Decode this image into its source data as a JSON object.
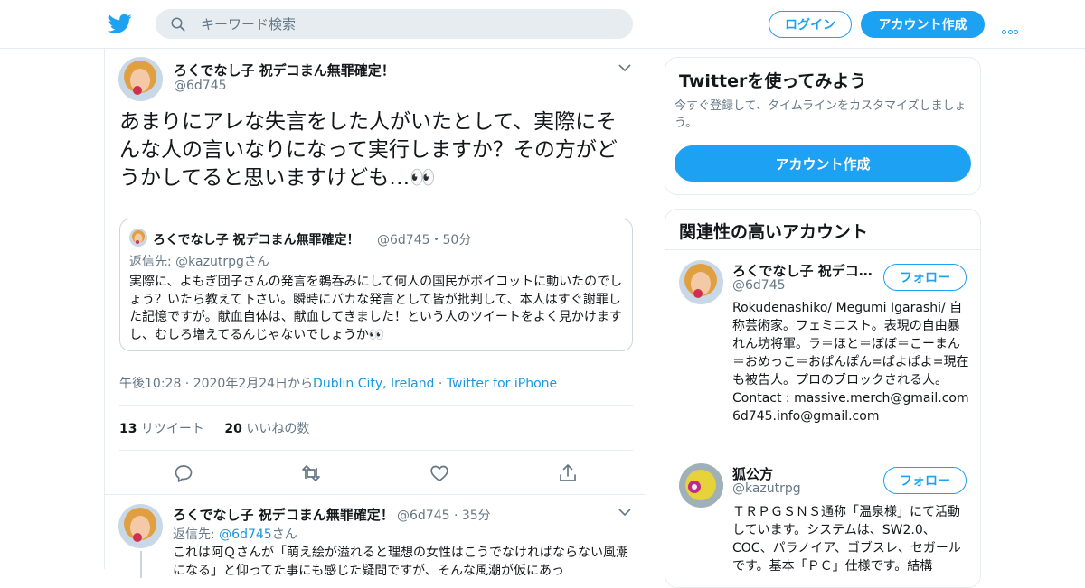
{
  "header": {
    "logo_icon": "twitter-bird-icon",
    "search_placeholder": "キーワード検索",
    "login_label": "ログイン",
    "signup_label": "アカウント作成",
    "more_icon": "more-dots-icon"
  },
  "tweet": {
    "author_name": "ろくでなし子 祝デコまん無罪確定！",
    "author_handle": "@6d745",
    "text": "あまりにアレな失言をした人がいたとして、実際にそんな人の言いなりになって実行しますか？その方がどうかしてると思いますけども…👀",
    "quote": {
      "name": "ろくでなし子 祝デコまん無罪確定！",
      "handle_time": "@6d745・50分",
      "reply_to": "返信先: @kazutrpgさん",
      "text": "実際に、よもぎ団子さんの発言を鵜呑みにして何人の国民がボイコットに動いたのでしょう？いたら教えて下さい。瞬時にバカな発言として皆が批判して、本人はすぐ謝罪した記憶ですが。献血自体は、献血してきました！という人のツイートをよく見かけますし、むしろ増えてるんじゃないでしょうか👀"
    },
    "time_prefix": "午後10:28 · 2020年2月24日から",
    "location": "Dublin City, Ireland",
    "source_sep": " · ",
    "source": "Twitter for iPhone",
    "retweet_count": "13",
    "retweet_label": " リツイート",
    "like_count": "20",
    "like_label": " いいねの数"
  },
  "actions": [
    "reply-icon",
    "retweet-icon",
    "like-icon",
    "share-icon"
  ],
  "reply": {
    "author_name": "ろくでなし子 祝デコまん無罪確定！",
    "handle_time": "@6d745 · 35分",
    "reply_to_prefix": "返信先: ",
    "reply_to_handle": "@6d745",
    "reply_to_suffix": "さん",
    "text": "これは阿Ｑさんが「萌え絵が溢れると理想の女性はこうでなければならない風潮になる」と仰ってた事にも感じた疑問ですが、そんな風潮が仮にあっ"
  },
  "sidebar": {
    "signup_card": {
      "title": "Twitterを使ってみよう",
      "desc": "今すぐ登録して、タイムラインをカスタマイズしましょう。",
      "button": "アカウント作成"
    },
    "related": {
      "title": "関連性の高いアカウント",
      "follow_label": "フォロー",
      "accounts": [
        {
          "name": "ろくでなし子 祝デコ…",
          "handle": "@6d745",
          "bio": "Rokudenashiko/ Megumi Igarashi/ 自称芸術家。フェミニスト。表現の自由暴れん坊将軍。ラ＝ほと＝ぼぼ＝こーまん＝おめっこ＝おぱんぽん=ぱよぱよ=現在も被告人。プロのブロックされる人。Contact : massive.merch@gmail.com 6d745.info@gmail.com"
        },
        {
          "name": "狐公方",
          "handle": "@kazutrpg",
          "bio": "ＴＲＰＧＳＮＳ通称「温泉様」にて活動しています。システムは、SW2.0、COC、パラノイア、ゴブスレ、セガールです。基本「ＰＣ」仕様です。結構"
        }
      ]
    }
  },
  "colors": {
    "accent": "#1da1f2",
    "link": "#1b95e0",
    "muted": "#657786",
    "border": "#e6ecf0"
  }
}
